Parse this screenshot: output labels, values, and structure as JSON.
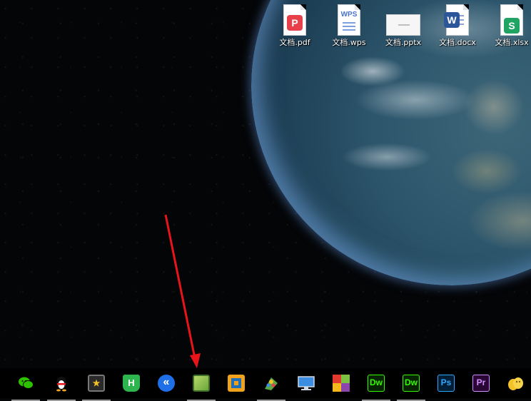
{
  "desktop_icons": [
    {
      "id": "pdf",
      "label": "文档.pdf",
      "badge": "P",
      "color": "#e8404b"
    },
    {
      "id": "wps",
      "label": "文档.wps",
      "badge": "WPS",
      "color": "#4a73c9"
    },
    {
      "id": "pptx",
      "label": "文档.pptx",
      "badge": "",
      "color": "#f6f6f6"
    },
    {
      "id": "docx",
      "label": "文档.docx",
      "badge": "W",
      "color": "#2b579a"
    },
    {
      "id": "xlsx",
      "label": "文档.xlsx",
      "badge": "S",
      "color": "#1fa463"
    }
  ],
  "taskbar": {
    "items": [
      {
        "name": "wechat",
        "glyph": "",
        "color": "#2dc100",
        "running": true
      },
      {
        "name": "qq",
        "glyph": "",
        "color": "#111111",
        "running": true
      },
      {
        "name": "media-app",
        "glyph": "★",
        "color": "#2a2a2a",
        "running": true
      },
      {
        "name": "hbuilder",
        "glyph": "H",
        "color": "#2fb550",
        "running": false
      },
      {
        "name": "browser-app",
        "glyph": "«",
        "color": "#1e6fe8",
        "running": false
      },
      {
        "name": "green-app",
        "glyph": "",
        "color": "#8dc63f",
        "running": true
      },
      {
        "name": "vmware",
        "glyph": "",
        "color": "#f1a21d",
        "running": false
      },
      {
        "name": "paint-app",
        "glyph": "",
        "color": "#5aa845",
        "running": true
      },
      {
        "name": "remote-desktop",
        "glyph": "",
        "color": "#3a8de0",
        "running": false
      },
      {
        "name": "tiles-app",
        "glyph": "",
        "color": "#e23a2f",
        "running": false
      },
      {
        "name": "dreamweaver",
        "glyph": "Dw",
        "color": "#35fa00",
        "running": true
      },
      {
        "name": "dreamweaver-2",
        "glyph": "Dw",
        "color": "#35fa00",
        "running": true
      },
      {
        "name": "photoshop",
        "glyph": "Ps",
        "color": "#31a8ff",
        "running": false
      },
      {
        "name": "premiere",
        "glyph": "Pr",
        "color": "#d291ff",
        "running": false
      },
      {
        "name": "peanut-app",
        "glyph": "",
        "color": "#f3c229",
        "running": false
      }
    ]
  },
  "annotation": {
    "color": "#e8141a"
  }
}
